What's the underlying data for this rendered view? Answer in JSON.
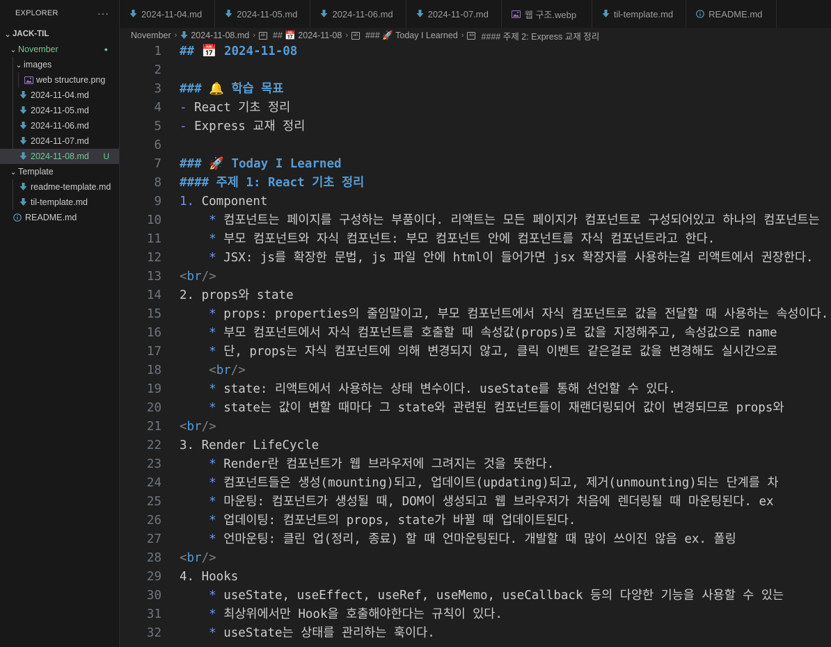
{
  "explorer": {
    "title": "EXPLORER",
    "more": "···",
    "root": "JACK-TIL",
    "items": [
      {
        "label": "November",
        "kind": "folder-open",
        "depth": 1,
        "color": "#73c991",
        "badge": "●",
        "badge_color": "#73c991"
      },
      {
        "label": "images",
        "kind": "folder-open",
        "depth": 2
      },
      {
        "label": "web structure.png",
        "kind": "image",
        "depth": 3
      },
      {
        "label": "2024-11-04.md",
        "kind": "markdown",
        "depth": 2
      },
      {
        "label": "2024-11-05.md",
        "kind": "markdown",
        "depth": 2
      },
      {
        "label": "2024-11-06.md",
        "kind": "markdown",
        "depth": 2
      },
      {
        "label": "2024-11-07.md",
        "kind": "markdown",
        "depth": 2
      },
      {
        "label": "2024-11-08.md",
        "kind": "markdown",
        "depth": 2,
        "color": "#73c991",
        "badge": "U",
        "badge_color": "#73c991",
        "selected": true
      },
      {
        "label": "Template",
        "kind": "folder-open",
        "depth": 1
      },
      {
        "label": "readme-template.md",
        "kind": "markdown",
        "depth": 2
      },
      {
        "label": "til-template.md",
        "kind": "markdown",
        "depth": 2
      },
      {
        "label": "README.md",
        "kind": "info",
        "depth": 1
      }
    ]
  },
  "tabs": [
    {
      "label": "2024-11-04.md",
      "icon": "markdown-icon"
    },
    {
      "label": "2024-11-05.md",
      "icon": "markdown-icon"
    },
    {
      "label": "2024-11-06.md",
      "icon": "markdown-icon"
    },
    {
      "label": "2024-11-07.md",
      "icon": "markdown-icon"
    },
    {
      "label": "웹 구조.webp",
      "icon": "image-icon"
    },
    {
      "label": "til-template.md",
      "icon": "markdown-icon"
    },
    {
      "label": "README.md",
      "icon": "info-icon"
    }
  ],
  "breadcrumb": [
    {
      "label": "November",
      "icon": ""
    },
    {
      "label": "2024-11-08.md",
      "icon": "markdown-icon"
    },
    {
      "label": "## 📅 2024-11-08",
      "icon": "symbol-icon"
    },
    {
      "label": "### 🚀 Today I Learned",
      "icon": "symbol-icon"
    },
    {
      "label": "#### 주제 2: Express 교재 정리",
      "icon": "symbol-icon"
    }
  ],
  "editor": {
    "lines": [
      {
        "n": "1",
        "segs": [
          {
            "t": "## ",
            "c": "h2"
          },
          {
            "t": "📅",
            "c": "emo"
          },
          {
            "t": " 2024-11-08",
            "c": "h2"
          }
        ]
      },
      {
        "n": "2",
        "segs": []
      },
      {
        "n": "3",
        "segs": [
          {
            "t": "### ",
            "c": "h3"
          },
          {
            "t": "🔔",
            "c": "emo"
          },
          {
            "t": " 학습 목표",
            "c": "h3"
          }
        ]
      },
      {
        "n": "4",
        "segs": [
          {
            "t": "- ",
            "c": "mk"
          },
          {
            "t": "React 기초 정리",
            "c": "code"
          }
        ]
      },
      {
        "n": "5",
        "segs": [
          {
            "t": "- ",
            "c": "mk"
          },
          {
            "t": "Express 교재 정리",
            "c": "code"
          }
        ]
      },
      {
        "n": "6",
        "segs": []
      },
      {
        "n": "7",
        "segs": [
          {
            "t": "### ",
            "c": "h3"
          },
          {
            "t": "🚀",
            "c": "emo"
          },
          {
            "t": " Today I Learned",
            "c": "h3"
          }
        ]
      },
      {
        "n": "8",
        "segs": [
          {
            "t": "#### 주제 1: React 기초 정리",
            "c": "h4"
          }
        ]
      },
      {
        "n": "9",
        "segs": [
          {
            "t": "1. ",
            "c": "mk"
          },
          {
            "t": "Component",
            "c": "code"
          }
        ]
      },
      {
        "n": "10",
        "segs": [
          {
            "t": "    * ",
            "c": "mk"
          },
          {
            "t": "컴포넌트는 페이지를 구성하는 부품이다. 리액트는 모든 페이지가 컴포넌트로 구성되어있고 하나의 컴포넌트는",
            "c": "code"
          }
        ]
      },
      {
        "n": "11",
        "segs": [
          {
            "t": "    * ",
            "c": "mk"
          },
          {
            "t": "부모 컴포넌트와 자식 컴포넌트: 부모 컴포넌트 안에 컴포넌트를 자식 컴포넌트라고 한다.",
            "c": "code"
          }
        ]
      },
      {
        "n": "12",
        "segs": [
          {
            "t": "    * ",
            "c": "mk"
          },
          {
            "t": "JSX: js를 확장한 문법, js 파일 안에 html이 들어가면 jsx 확장자를 사용하는걸 리액트에서 권장한다.",
            "c": "code"
          }
        ]
      },
      {
        "n": "13",
        "segs": [
          {
            "t": "<",
            "c": "tagb"
          },
          {
            "t": "br",
            "c": "tagn"
          },
          {
            "t": "/>",
            "c": "tagb"
          }
        ]
      },
      {
        "n": "14",
        "segs": [
          {
            "t": "2. ",
            "c": "code"
          },
          {
            "t": "props와 state",
            "c": "code"
          }
        ]
      },
      {
        "n": "15",
        "segs": [
          {
            "t": "    * ",
            "c": "mk"
          },
          {
            "t": "props: properties의 줄임말이고, 부모 컴포넌트에서 자식 컴포넌트로 값을 전달할 때 사용하는 속성이다.",
            "c": "code"
          }
        ]
      },
      {
        "n": "16",
        "segs": [
          {
            "t": "    * ",
            "c": "mk"
          },
          {
            "t": "부모 컴포넌트에서 자식 컴포넌트를 호출할 때 속성값(props)로 값을 지정해주고, 속성값으로 name",
            "c": "code"
          }
        ]
      },
      {
        "n": "17",
        "segs": [
          {
            "t": "    * ",
            "c": "mk"
          },
          {
            "t": "단, props는 자식 컴포넌트에 의해 변경되지 않고, 클릭 이벤트 같은걸로 값을 변경해도 실시간으로",
            "c": "code"
          }
        ]
      },
      {
        "n": "18",
        "segs": [
          {
            "t": "    <",
            "c": "tagb"
          },
          {
            "t": "br",
            "c": "tagn"
          },
          {
            "t": "/>",
            "c": "tagb"
          }
        ]
      },
      {
        "n": "19",
        "segs": [
          {
            "t": "    * ",
            "c": "mk"
          },
          {
            "t": "state: 리액트에서 사용하는 상태 변수이다. useState를 통해 선언할 수 있다.",
            "c": "code"
          }
        ]
      },
      {
        "n": "20",
        "segs": [
          {
            "t": "    * ",
            "c": "mk"
          },
          {
            "t": "state는 값이 변할 때마다 그 state와 관련된 컴포넌트들이 재랜더링되어 값이 변경되므로 props와",
            "c": "code"
          }
        ]
      },
      {
        "n": "21",
        "segs": [
          {
            "t": "<",
            "c": "tagb"
          },
          {
            "t": "br",
            "c": "tagn"
          },
          {
            "t": "/>",
            "c": "tagb"
          }
        ]
      },
      {
        "n": "22",
        "segs": [
          {
            "t": "3. ",
            "c": "code"
          },
          {
            "t": "Render LifeCycle",
            "c": "code"
          }
        ]
      },
      {
        "n": "23",
        "segs": [
          {
            "t": "    * ",
            "c": "mk"
          },
          {
            "t": "Render란 컴포넌트가 웹 브라우저에 그려지는 것을 뜻한다.",
            "c": "code"
          }
        ]
      },
      {
        "n": "24",
        "segs": [
          {
            "t": "    * ",
            "c": "mk"
          },
          {
            "t": "컴포넌트들은 생성(mounting)되고, 업데이트(updating)되고, 제거(unmounting)되는 단계를 차",
            "c": "code"
          }
        ]
      },
      {
        "n": "25",
        "segs": [
          {
            "t": "    * ",
            "c": "mk"
          },
          {
            "t": "마운팅: 컴포넌트가 생성될 때, DOM이 생성되고 웹 브라우저가 처음에 렌더링될 때 마운팅된다. ex",
            "c": "code"
          }
        ]
      },
      {
        "n": "26",
        "segs": [
          {
            "t": "    * ",
            "c": "mk"
          },
          {
            "t": "업데이팅: 컴포넌트의 props, state가 바뀔 때 업데이트된다.",
            "c": "code"
          }
        ]
      },
      {
        "n": "27",
        "segs": [
          {
            "t": "    * ",
            "c": "mk"
          },
          {
            "t": "언마운팅: 클린 업(정리, 종료) 할 때 언마운팅된다. 개발할 때 많이 쓰이진 않음 ex. 폴링",
            "c": "code"
          }
        ]
      },
      {
        "n": "28",
        "segs": [
          {
            "t": "<",
            "c": "tagb"
          },
          {
            "t": "br",
            "c": "tagn"
          },
          {
            "t": "/>",
            "c": "tagb"
          }
        ]
      },
      {
        "n": "29",
        "segs": [
          {
            "t": "4. ",
            "c": "code"
          },
          {
            "t": "Hooks",
            "c": "code"
          }
        ]
      },
      {
        "n": "30",
        "segs": [
          {
            "t": "    * ",
            "c": "mk"
          },
          {
            "t": "useState, useEffect, useRef, useMemo, useCallback 등의 다양한 기능을 사용할 수 있는",
            "c": "code"
          }
        ]
      },
      {
        "n": "31",
        "segs": [
          {
            "t": "    * ",
            "c": "mk"
          },
          {
            "t": "최상위에서만 Hook을 호출해야한다는 규칙이 있다.",
            "c": "code"
          }
        ]
      },
      {
        "n": "32",
        "segs": [
          {
            "t": "    * ",
            "c": "mk"
          },
          {
            "t": "useState는 상태를 관리하는 훅이다.",
            "c": "code"
          }
        ]
      }
    ]
  }
}
